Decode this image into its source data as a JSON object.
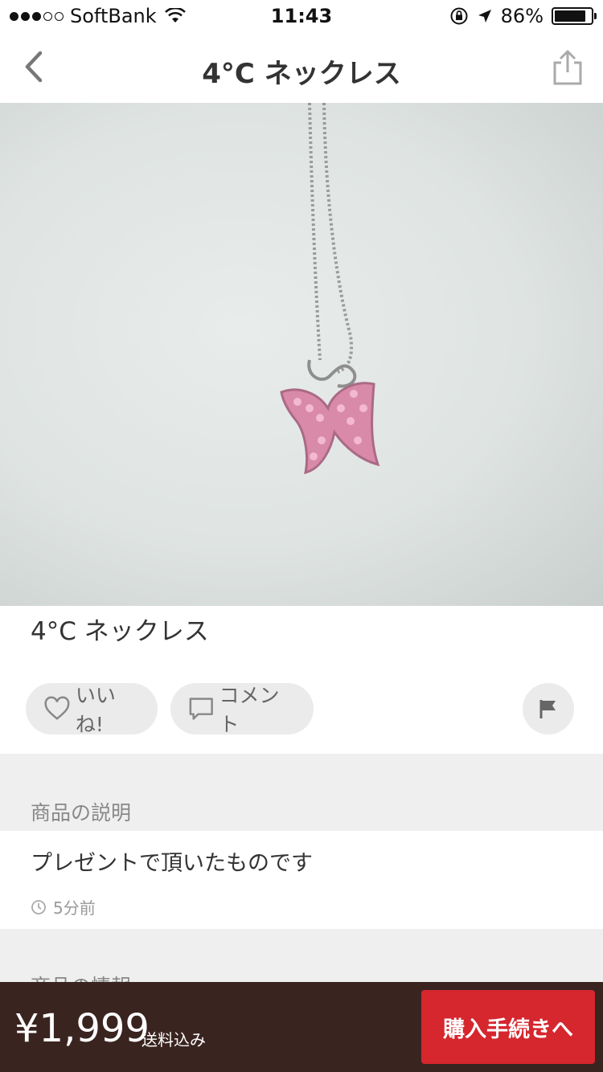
{
  "status_bar": {
    "carrier": "SoftBank",
    "time": "11:43",
    "battery": "86%",
    "battery_level": 0.86
  },
  "nav": {
    "title": "4°C ネックレス"
  },
  "item": {
    "title": "4°C ネックレス",
    "like_label": "いいね!",
    "comment_label": "コメント"
  },
  "description": {
    "section_label": "商品の説明",
    "text": "プレゼントで頂いたものです",
    "posted": "5分前"
  },
  "info": {
    "section_label": "商品の情報"
  },
  "purchase": {
    "price": "¥1,999",
    "shipping": "送料込み",
    "buy_label": "購入手続きへ"
  },
  "colors": {
    "accent": "#d6262e",
    "bottom_bar": "#3a2420"
  },
  "icons": [
    "signal-dots-icon",
    "wifi-icon",
    "rotation-lock-icon",
    "location-arrow-icon",
    "battery-icon",
    "back-chevron-icon",
    "share-icon",
    "heart-icon",
    "comment-icon",
    "flag-icon",
    "clock-icon"
  ]
}
